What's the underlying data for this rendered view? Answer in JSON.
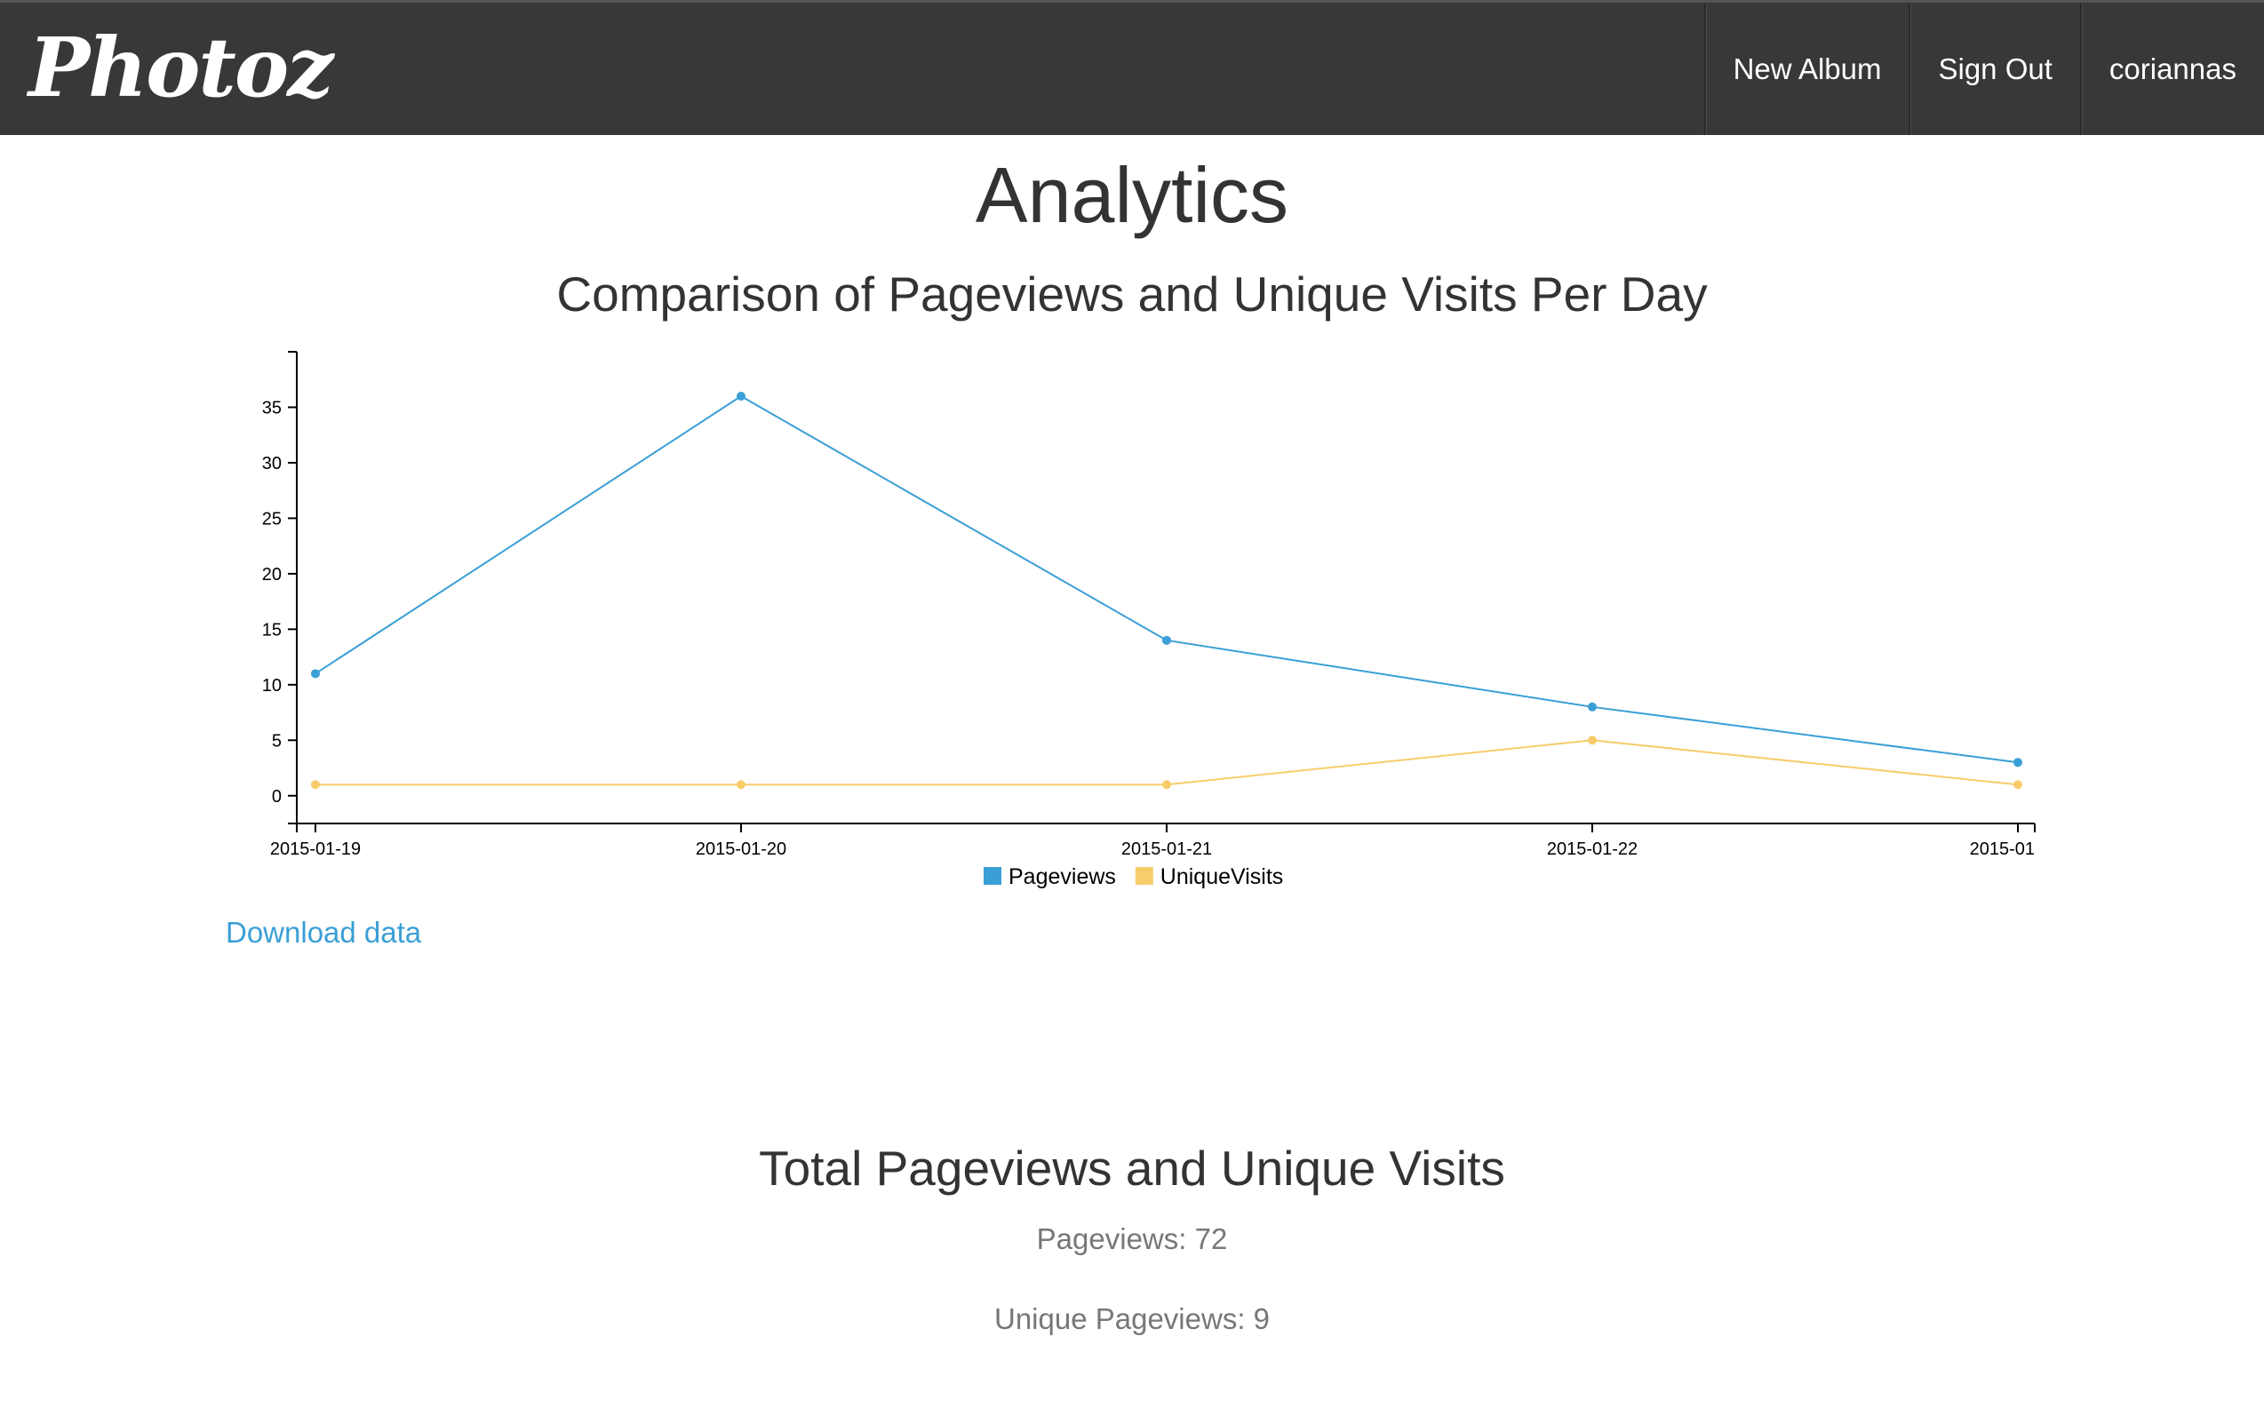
{
  "navbar": {
    "brand": "Photoz",
    "items": [
      {
        "label": "New Album"
      },
      {
        "label": "Sign Out"
      },
      {
        "label": "coriannas"
      }
    ]
  },
  "page": {
    "title": "Analytics"
  },
  "chart": {
    "title": "Comparison of Pageviews and Unique Visits Per Day"
  },
  "chart_data": {
    "type": "line",
    "title": "Comparison of Pageviews and Unique Visits Per Day",
    "x": [
      "2015-01-19",
      "2015-01-20",
      "2015-01-21",
      "2015-01-22",
      "2015-01"
    ],
    "series": [
      {
        "name": "Pageviews",
        "color": "#3a9fd6",
        "values": [
          11,
          36,
          14,
          8,
          3
        ]
      },
      {
        "name": "UniqueVisits",
        "color": "#f7cd6b",
        "values": [
          1,
          1,
          1,
          5,
          1
        ]
      }
    ],
    "yticks": [
      0,
      5,
      10,
      15,
      20,
      25,
      30,
      35
    ],
    "ylim": [
      -2.5,
      40
    ],
    "grid": false,
    "legend": "bottom-center"
  },
  "download": {
    "label": "Download data"
  },
  "totals": {
    "title": "Total Pageviews and Unique Visits",
    "pageviews": "Pageviews: 72",
    "unique": "Unique Pageviews: 9"
  }
}
